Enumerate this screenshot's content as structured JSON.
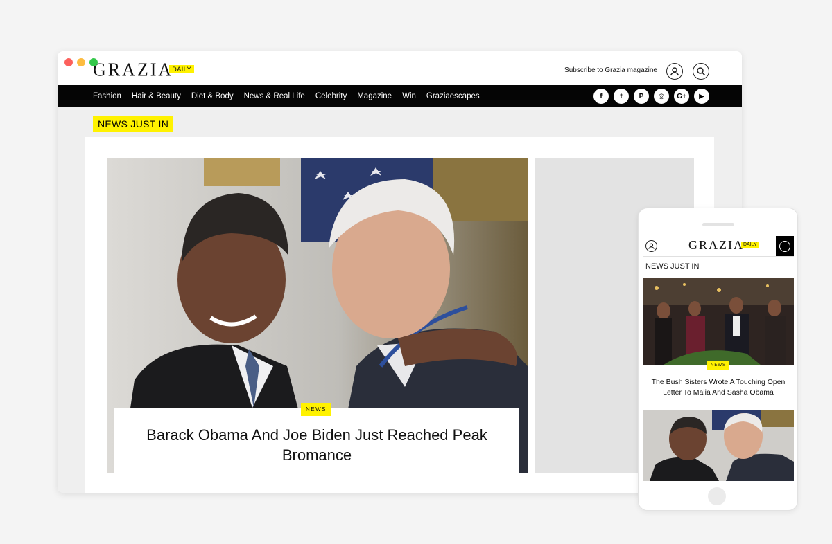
{
  "brand": {
    "wordmark": "GRAZIA",
    "tag": "DAILY",
    "accent": "#fff200"
  },
  "header": {
    "subscribe_label": "Subscribe to Grazia magazine",
    "user_icon": "user-icon",
    "search_icon": "search-icon"
  },
  "nav": {
    "items": [
      "Fashion",
      "Hair & Beauty",
      "Diet & Body",
      "News & Real Life",
      "Celebrity",
      "Magazine",
      "Win",
      "Graziaescapes"
    ]
  },
  "social": [
    {
      "icon": "facebook-icon",
      "glyph": "f"
    },
    {
      "icon": "twitter-icon",
      "glyph": "t"
    },
    {
      "icon": "pinterest-icon",
      "glyph": "P"
    },
    {
      "icon": "instagram-icon",
      "glyph": "◎"
    },
    {
      "icon": "google-plus-icon",
      "glyph": "G+"
    },
    {
      "icon": "youtube-icon",
      "glyph": "▶"
    }
  ],
  "section": {
    "label": "NEWS JUST IN"
  },
  "hero": {
    "badge": "NEWS",
    "headline": "Barack Obama And Joe Biden Just Reached Peak Bromance"
  },
  "mobile": {
    "section_label": "NEWS JUST IN",
    "menu_icon": "menu-icon",
    "article1": {
      "badge": "NEWS",
      "title": "The Bush Sisters Wrote A Touching Open Letter To Malia And Sasha Obama"
    }
  }
}
